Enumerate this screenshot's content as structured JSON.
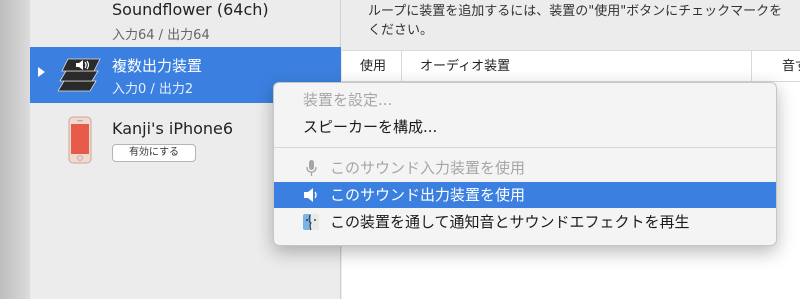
{
  "sidebar": {
    "devices": [
      {
        "name": "Soundflower (64ch)",
        "io": "入力64 / 出力64"
      },
      {
        "name": "複数出力装置",
        "io": "入力0 / 出力2"
      },
      {
        "name": "Kanji's iPhone6",
        "button": "有効にする"
      }
    ]
  },
  "main": {
    "info_line1": "ループに装置を追加するには、装置の\"使用\"ボタンにチェックマークを",
    "info_line2": "ください。",
    "columns": {
      "use": "使用",
      "device": "オーディオ装置",
      "sound": "音ず"
    }
  },
  "context_menu": {
    "items": [
      {
        "label": "装置を設定...",
        "state": "disabled"
      },
      {
        "label": "スピーカーを構成...",
        "state": "enabled"
      },
      {
        "label": "このサウンド入力装置を使用",
        "state": "disabled",
        "icon": "microphone-icon"
      },
      {
        "label": "このサウンド出力装置を使用",
        "state": "selected",
        "icon": "speaker-icon"
      },
      {
        "label": "この装置を通して通知音とサウンドエフェクトを再生",
        "state": "enabled",
        "icon": "finder-icon"
      }
    ]
  },
  "colors": {
    "selection": "#3b80e0",
    "sidebar_bg": "#ececec",
    "menu_bg": "#f4f4f4"
  }
}
